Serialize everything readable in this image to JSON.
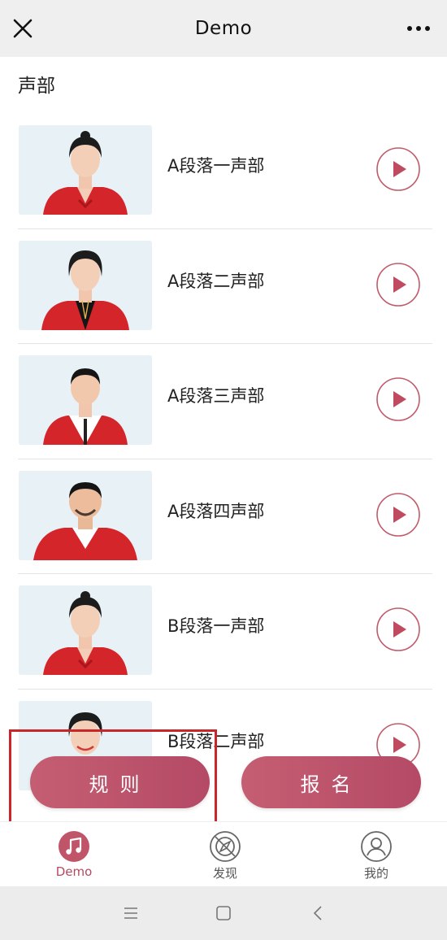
{
  "header": {
    "title": "Demo"
  },
  "section": {
    "title": "声部"
  },
  "items": [
    {
      "label": "A段落一声部",
      "person": "woman-1"
    },
    {
      "label": "A段落二声部",
      "person": "woman-2"
    },
    {
      "label": "A段落三声部",
      "person": "man-1"
    },
    {
      "label": "A段落四声部",
      "person": "man-2"
    },
    {
      "label": "B段落一声部",
      "person": "woman-1"
    },
    {
      "label": "B段落二声部",
      "person": "woman-3"
    }
  ],
  "actions": {
    "rules": "规则",
    "signup": "报名"
  },
  "tabs": [
    {
      "label": "Demo",
      "icon": "music-note-icon",
      "active": true
    },
    {
      "label": "发现",
      "icon": "compass-icon",
      "active": false
    },
    {
      "label": "我的",
      "icon": "user-icon",
      "active": false
    }
  ],
  "colors": {
    "accent": "#b64a62",
    "button_start": "#c55e72",
    "button_end": "#b44a66",
    "highlight": "#c9262a"
  }
}
